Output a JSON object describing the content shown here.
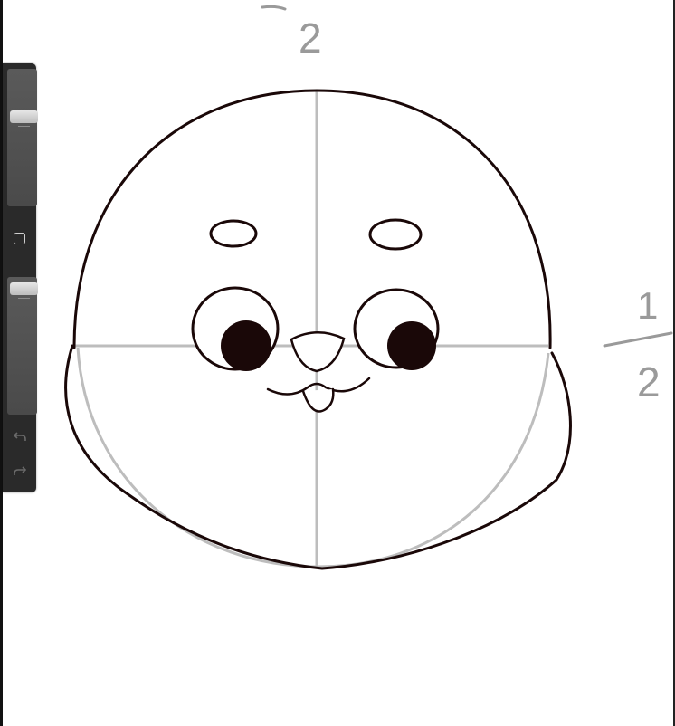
{
  "canvas": {
    "background": "#ffffff",
    "annotations": {
      "top_fraction_digit": "2",
      "right_fraction_numerator": "1",
      "right_fraction_denominator": "2"
    },
    "colors": {
      "ink": "#1a0808",
      "guide": "#bdbdbd",
      "annotation": "#9a9a9a"
    }
  },
  "sidebar": {
    "brush_size_level": 0.67,
    "opacity_level": 0.97,
    "icons": {
      "modify": "square-icon",
      "undo": "undo-icon",
      "redo": "redo-icon"
    }
  }
}
